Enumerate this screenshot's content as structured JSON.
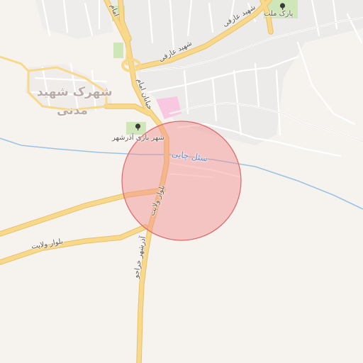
{
  "map": {
    "colors": {
      "background": "#f6f3ef",
      "primary_road": "#f8d98c",
      "primary_road_casing": "#e8c06b",
      "minor_road": "#ffffff",
      "minor_road_casing": "#d9d4ce",
      "urban_area": "#ecebe9",
      "river": "#9cc3e6",
      "park": "#cfe6b8",
      "pink_area": "#f7c8e0",
      "marker_fill": "#f28b8b",
      "marker_stroke": "#e06666"
    },
    "marker": {
      "type": "circle-area",
      "opacity": 0.45
    },
    "labels": {
      "park_mellat": "پارک ملت",
      "shahid_arefi_upper": "شهید عارفی",
      "shahid_arefi_lower": "شهید عارفی",
      "khiyaban_emam": "خیابان امام",
      "emam": "امام",
      "shahrak_line1": "شهرک شهید",
      "shahrak_line2": "مدنی",
      "shahr_bazi": "شهر بازی آذرشهر",
      "river": "سئل چایی",
      "bolvar_velayat_diag": "بلوار ولایت",
      "bolvar_velayat_left": "بلوار ولایت",
      "azarshahr_kharvan": "آذرشهر خراجو"
    },
    "icons": {
      "park_mellat": "tree-icon",
      "shahr_bazi": "tree-icon"
    }
  }
}
